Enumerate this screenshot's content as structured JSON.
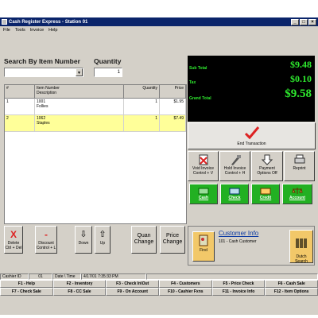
{
  "window": {
    "title": "Cash Register Express - Station 01"
  },
  "menu": [
    "File",
    "Tools",
    "Invoice",
    "Help"
  ],
  "search": {
    "label": "Search By Item Number",
    "value": ""
  },
  "quantity": {
    "label": "Quantity",
    "value": "1"
  },
  "grid": {
    "headers": [
      "#",
      "Item Number\nDescription",
      "Quantity",
      "Price"
    ],
    "rows": [
      {
        "n": "1",
        "item": "1001",
        "desc": "Follies",
        "qty": "1",
        "price": "$1.95"
      },
      {
        "n": "2",
        "item": "1062",
        "desc": "Staples",
        "qty": "1",
        "price": "$7.49"
      }
    ]
  },
  "totals": {
    "subtotal_label": "Sub Total",
    "subtotal": "$9.48",
    "tax_label": "Tax",
    "tax": "$0.10",
    "grand_label": "Grand Total",
    "grand": "$9.58"
  },
  "end_transaction": "End Transaction",
  "actions": [
    {
      "label": "Void Invoice\nControl + V",
      "icon": "void-invoice"
    },
    {
      "label": "Hold Invoice\nControl + H",
      "icon": "hold-invoice"
    },
    {
      "label": "Payment\nOptions Off",
      "icon": "payment-options"
    },
    {
      "label": "Reprint",
      "icon": "reprint"
    }
  ],
  "payments": [
    "Cash",
    "Check",
    "Credit",
    "Account"
  ],
  "bottom_buttons": [
    {
      "label": "Delete\nCtrl + Del",
      "icon": "delete"
    },
    {
      "label": "Discount\nControl + L",
      "icon": "discount"
    },
    {
      "label": "Down",
      "icon": "arrow-down"
    },
    {
      "label": "Up",
      "icon": "arrow-up"
    },
    {
      "label": "Quan\nChange",
      "icon": ""
    },
    {
      "label": "Price\nChange",
      "icon": ""
    }
  ],
  "customer": {
    "find_label": "Find",
    "title": "Customer Info",
    "line": "101 - Cash Customer",
    "search_label": "Dutch\nSearch"
  },
  "status": {
    "cashier_label": "Cashier ID",
    "cashier": "01",
    "date_label": "Date \\ Time",
    "datetime": "4/17/01 7:35:33 PM"
  },
  "fkeys": [
    "F1 - Help",
    "F2 - Inventory",
    "F3 - Check In\\Out",
    "F4 - Customers",
    "F5 - Price Check",
    "F6 - Cash Sale",
    "F7 - Check Sale",
    "F8 - CC Sale",
    "F9 - On Account",
    "F10 - Cashier Fxns",
    "F11 - Invoice Info",
    "F12 - Item Options"
  ]
}
